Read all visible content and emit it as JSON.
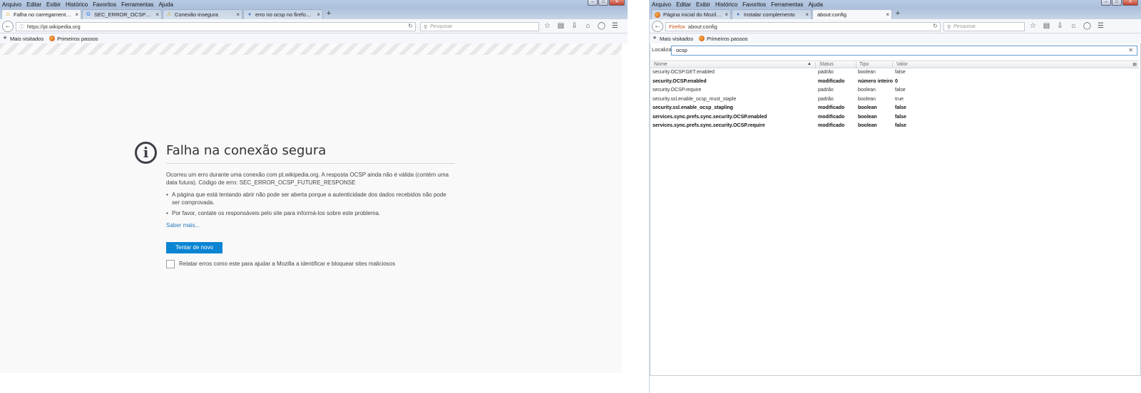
{
  "left": {
    "menu": [
      "Arquivo",
      "Editar",
      "Exibir",
      "Histórico",
      "Favoritos",
      "Ferramentas",
      "Ajuda"
    ],
    "tabs": [
      {
        "label": "Falha no carregamento da ...",
        "icon": "warning-icon",
        "active": true
      },
      {
        "label": "SEC_ERROR_OCSP_FUTURE...",
        "icon": "google-icon",
        "active": false
      },
      {
        "label": "Conexão insegura",
        "icon": "warning-icon",
        "active": false
      },
      {
        "label": "erro no ocsp no firefox - Re...",
        "icon": "puzzle-icon",
        "active": false
      }
    ],
    "url": "https://pt.wikipedia.org",
    "search_placeholder": "Pesquisar",
    "bookmarks": [
      "Mais visitados",
      "Primeiros passos"
    ],
    "error": {
      "title": "Falha na conexão segura",
      "description": "Ocorreu um erro durante uma conexão com pt.wikipedia.org. A resposta OCSP ainda não é válida (contém uma data futura). Código de erro: SEC_ERROR_OCSP_FUTURE_RESPONSE",
      "bullets": [
        "A página que está tentando abrir não pode ser aberta porque a autenticidade dos dados recebidos não pode ser comprovada.",
        "Por favor, contate os responsáveis pelo site para informá-los sobre este problema."
      ],
      "learn_more": "Saber mais...",
      "retry_button": "Tentar de novo",
      "report_checkbox": "Relatar erros como este para ajudar a Mozilla a identificar e bloquear sites maliciosos",
      "report_checked": false
    }
  },
  "right": {
    "menu": [
      "Arquivo",
      "Editar",
      "Exibir",
      "Histórico",
      "Favoritos",
      "Ferramentas",
      "Ajuda"
    ],
    "tabs": [
      {
        "label": "Página inicial do Mozilla Fi...",
        "icon": "firefox-icon",
        "active": false
      },
      {
        "label": "Instalar complemento",
        "icon": "puzzle-icon",
        "active": false
      },
      {
        "label": "about:config",
        "icon": "",
        "active": true
      }
    ],
    "url_identity": "Firefox",
    "url": "about:config",
    "search_placeholder": "Pesquisar",
    "bookmarks": [
      "Mais visitados",
      "Primeiros passos"
    ],
    "find_label": "Localizar:",
    "find_value": "ocsp",
    "columns": [
      "Nome",
      "Status",
      "Tipo",
      "Valor"
    ],
    "prefs": [
      {
        "name": "security.OCSP.GET.enabled",
        "status": "padrão",
        "type": "boolean",
        "value": "false",
        "modified": false
      },
      {
        "name": "security.OCSP.enabled",
        "status": "modificado",
        "type": "número inteiro",
        "value": "0",
        "modified": true
      },
      {
        "name": "security.OCSP.require",
        "status": "padrão",
        "type": "boolean",
        "value": "false",
        "modified": false
      },
      {
        "name": "security.ssl.enable_ocsp_must_staple",
        "status": "padrão",
        "type": "boolean",
        "value": "true",
        "modified": false
      },
      {
        "name": "security.ssl.enable_ocsp_stapling",
        "status": "modificado",
        "type": "boolean",
        "value": "false",
        "modified": true
      },
      {
        "name": "services.sync.prefs.sync.security.OCSP.enabled",
        "status": "modificado",
        "type": "boolean",
        "value": "false",
        "modified": true
      },
      {
        "name": "services.sync.prefs.sync.security.OCSP.require",
        "status": "modificado",
        "type": "boolean",
        "value": "false",
        "modified": true
      }
    ]
  }
}
